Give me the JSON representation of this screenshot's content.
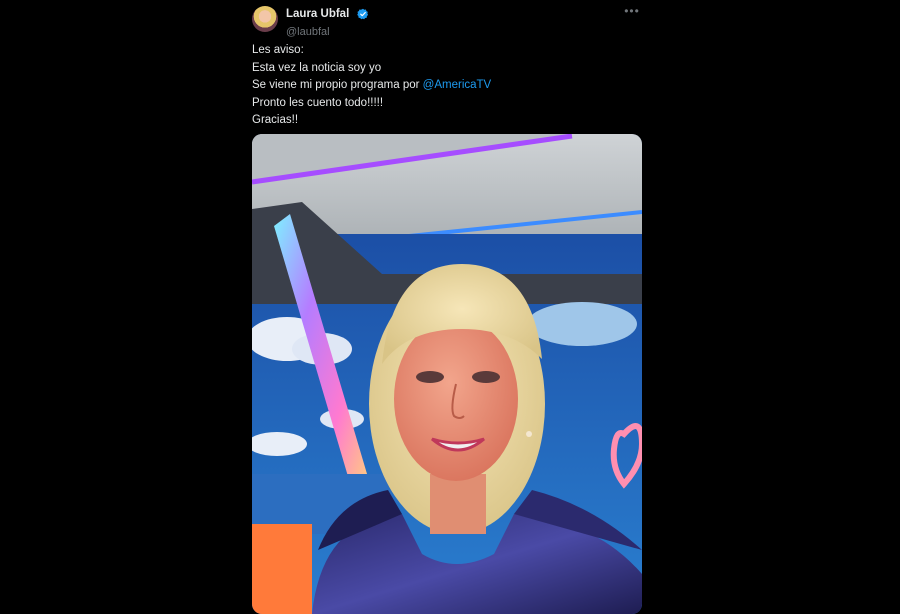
{
  "author": {
    "display_name": "Laura Ubfal",
    "handle": "@laubfal",
    "verified": true
  },
  "menu_icon": "more-horizontal-icon",
  "tweet_text": {
    "line1": "Les aviso:",
    "line2": "Esta vez la noticia soy yo",
    "line3_prefix": "Se viene mi propio programa por ",
    "line3_mention": "@AmericaTV",
    "line4": "Pronto les cuento todo!!!!!",
    "line5": "Gracias!!"
  },
  "colors": {
    "background": "#000000",
    "text": "#e7e9ea",
    "secondary": "#71767b",
    "link": "#1d9bf0",
    "verified": "#1d9bf0"
  },
  "media": {
    "type": "photo",
    "subject": "selfie-in-tv-studio"
  }
}
